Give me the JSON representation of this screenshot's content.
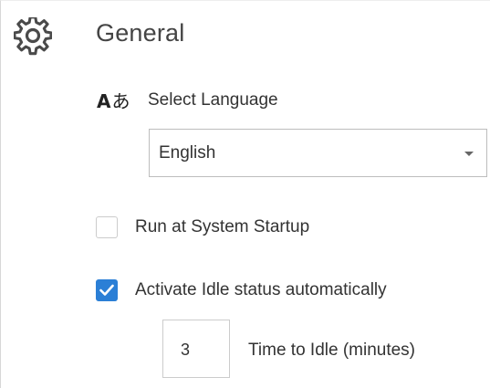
{
  "section": {
    "icon": "gear-icon",
    "title": "General"
  },
  "language": {
    "icon": "language-icon",
    "icon_glyph_latin": "A",
    "icon_glyph_kana": "あ",
    "label": "Select Language",
    "selected": "English"
  },
  "run_at_startup": {
    "label": "Run at System Startup",
    "checked": false
  },
  "idle": {
    "label": "Activate Idle status automatically",
    "checked": true,
    "minutes_value": "3",
    "minutes_label": "Time to Idle (minutes)"
  },
  "colors": {
    "accent": "#2b7fd6",
    "text": "#333333",
    "border": "#cccccc"
  }
}
